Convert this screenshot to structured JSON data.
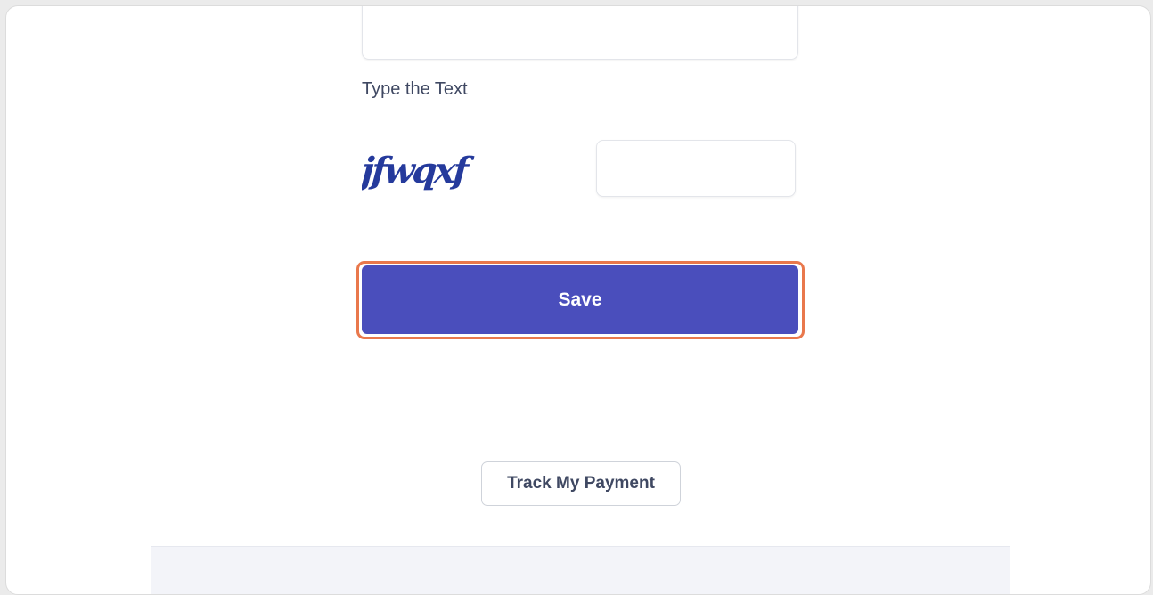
{
  "form": {
    "captcha_label": "Type the Text",
    "captcha_text": "jfwqxf",
    "captcha_input_value": "",
    "captcha_input_placeholder": "",
    "save_label": "Save"
  },
  "footer": {
    "track_payment_label": "Track My Payment"
  },
  "colors": {
    "primary_button": "#4a4ebc",
    "highlight_outline": "#e9784c",
    "captcha_ink": "#253a9c",
    "label_text": "#3f4862"
  }
}
